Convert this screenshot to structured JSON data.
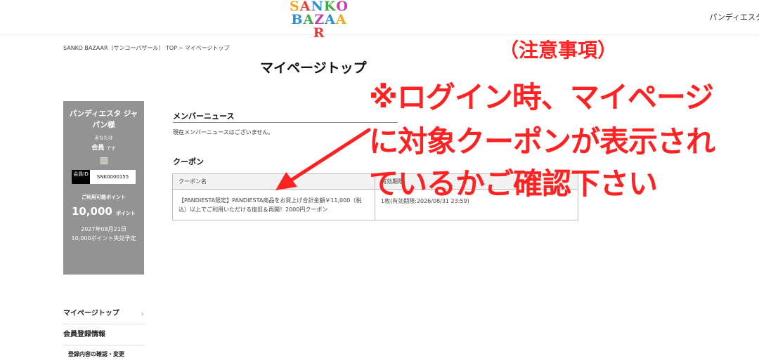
{
  "header": {
    "logo_line1": [
      "S",
      "A",
      "N",
      "K",
      "O"
    ],
    "logo_line2": [
      "B",
      "A",
      "Z",
      "A",
      "A",
      "R"
    ],
    "logo_colors": [
      "#f0a81c",
      "#e63939",
      "#2a8fd6",
      "#41a84a",
      "#c43fa6",
      "#2a8fd6"
    ],
    "user_text": "パンディエスタ"
  },
  "breadcrumb": {
    "home": "SANKO BAZAAR（サンコーバザール） TOP",
    "separator": ">",
    "current": "マイページトップ"
  },
  "page_title": "マイページトップ",
  "member": {
    "name": "パンディエスタ ジャパン様",
    "you_are": "あなたは",
    "rank": "会員",
    "rank_suffix": "です",
    "id_label": "会員ID",
    "id_value": "SNK0000155",
    "points_label": "ご利用可能ポイント",
    "points_value": "10,000",
    "points_unit": "ポイント",
    "expire_date": "2027年08月21日",
    "expire_text": "10,000ポイント失効予定"
  },
  "side_nav": {
    "item1": "マイページトップ",
    "item2": "会員登録情報",
    "sub1": "登録内容の確認・変更",
    "chevron": "›"
  },
  "news": {
    "title": "メンバーニュース",
    "empty": "現在メンバーニュースはございません。"
  },
  "coupon": {
    "title": "クーポン",
    "headers": [
      "クーポン名",
      "有効期限"
    ],
    "rows": [
      {
        "name": "【PANDIESTA限定】PANDIESTA商品をお買上げ合計金額￥11,000（税込）以上でご利用いただける復旧＆再開！2000円クーポン",
        "limit": "1枚(有効期限:2026/08/31 23:59)"
      }
    ]
  },
  "annotation": {
    "heading": "（注意事項）",
    "line1": "※ログイン時、マイページ",
    "line2": "に対象クーポンが表示され",
    "line3": "ているかご確認下さい",
    "color": "#ff2222"
  }
}
